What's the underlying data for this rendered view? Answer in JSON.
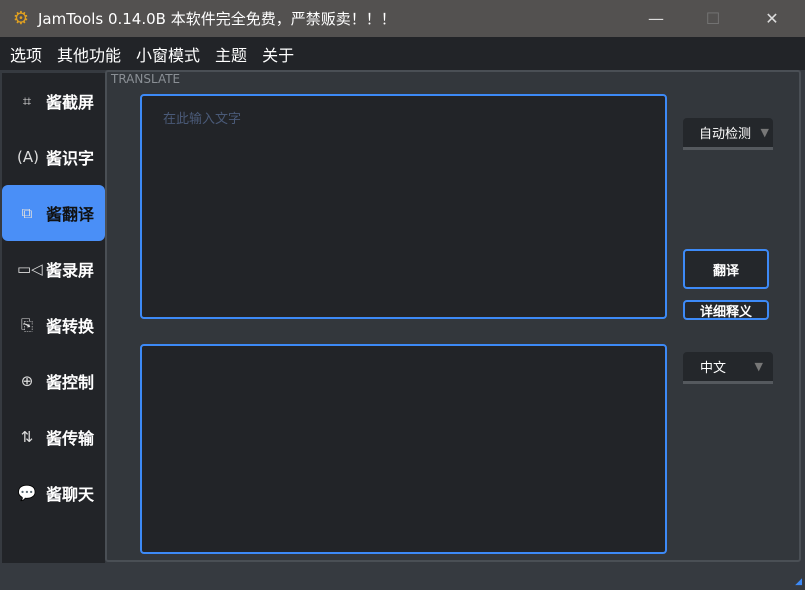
{
  "window": {
    "title": "JamTools 0.14.0B  本软件完全免费，严禁贩卖！！！",
    "logo_icon": "gear-logo-icon",
    "minimize": "—",
    "maximize": "☐",
    "close": "✕"
  },
  "menu": [
    "选项",
    "其他功能",
    "小窗模式",
    "主题",
    "关于"
  ],
  "sidebar": [
    {
      "label": "酱截屏",
      "icon": "crop-icon",
      "glyph": "⌗"
    },
    {
      "label": "酱识字",
      "icon": "ocr-icon",
      "glyph": "(A)"
    },
    {
      "label": "酱翻译",
      "icon": "translate-icon",
      "glyph": "⧉",
      "active": true
    },
    {
      "label": "酱录屏",
      "icon": "video-camera-icon",
      "glyph": "▭◁"
    },
    {
      "label": "酱转换",
      "icon": "file-convert-icon",
      "glyph": "⎘"
    },
    {
      "label": "酱控制",
      "icon": "control-icon",
      "glyph": "⊕"
    },
    {
      "label": "酱传输",
      "icon": "transfer-icon",
      "glyph": "⇅"
    },
    {
      "label": "酱聊天",
      "icon": "chat-icon",
      "glyph": "💬"
    }
  ],
  "translate": {
    "section": "TRANSLATE",
    "input_placeholder": "在此输入文字",
    "input_value": "",
    "output_value": "",
    "source_lang": "自动检测",
    "target_lang": "中文",
    "translate_button": "翻译",
    "detail_button": "详细释义"
  },
  "colors": {
    "accent": "#3d8af7",
    "active_item": "#4a8ff7"
  }
}
